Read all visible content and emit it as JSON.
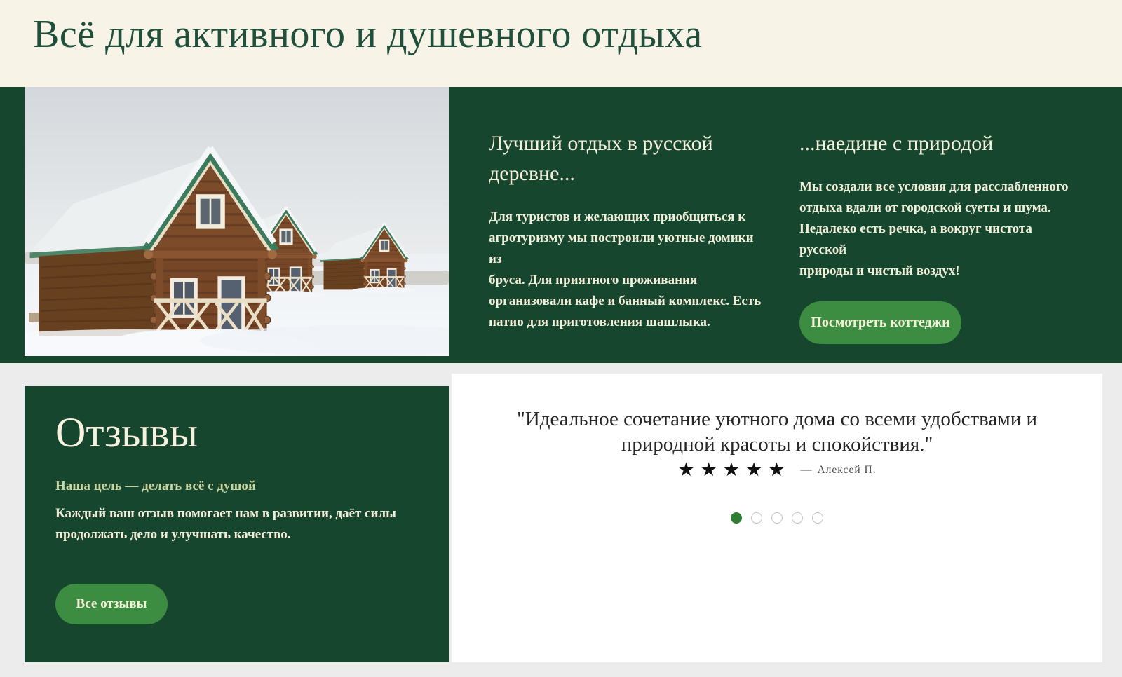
{
  "header": {
    "title": "Всё для активного и душевного отдыха"
  },
  "hero": {
    "col1": {
      "heading": "Лучший отдых в русской\nдеревне...",
      "paragraph": "Для туристов и желающих приобщиться к\nагротуризму мы построили уютные домики из\nбруса. Для приятного проживания\nорганизовали кафе и банный комплекс. Есть\nпатио для приготовления шашлыка."
    },
    "col2": {
      "heading": "...наедине с природой",
      "paragraph": "Мы создали все условия для расслабленного\nотдыха вдали от городской суеты и шума.\nНедалеко есть речка, а вокруг чистота русской\nприроды и чистый воздух!",
      "button_label": "Посмотреть коттеджи"
    }
  },
  "reviews": {
    "heading": "Отзывы",
    "subtitle": "Наша цель — делать всё с душой",
    "paragraph": "Каждый ваш отзыв помогает нам в развитии, даёт силы\nпродолжать дело и улучшать качество.",
    "button_label": "Все отзывы"
  },
  "testimonial": {
    "quote": "\"Идеальное сочетание уютного дома со всеми удобствами и\nприродной красоты и спокойствия.\"",
    "stars": "★★★★★",
    "rating": 5,
    "separator": "—",
    "author": "Алексей П.",
    "carousel": {
      "count": 5,
      "active_index": 1
    }
  },
  "colors": {
    "dark_green_background": "#16472e",
    "button_green": "#3c8c41",
    "cream_band": "#f7f3e7",
    "title_green": "#20503c",
    "pale_green_subtitle": "#c9d4a0",
    "active_dot_green": "#2e7d32",
    "page_background": "#ececec"
  }
}
